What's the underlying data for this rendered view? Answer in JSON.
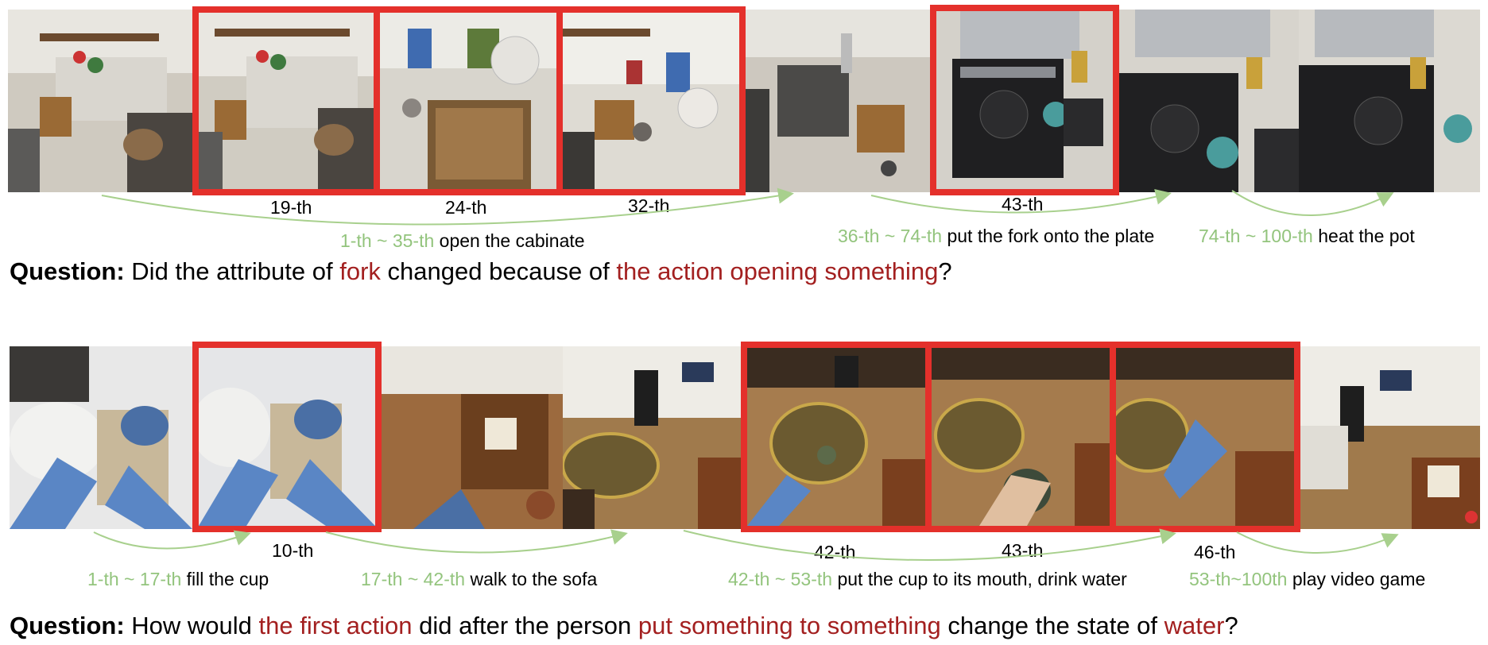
{
  "colors": {
    "highlight_border": "#e4302b",
    "action_range": "#93c47d",
    "question_highlight": "#a32020",
    "arrow": "#a8d08d"
  },
  "example1": {
    "frame_labels": [
      "19-th",
      "24-th",
      "32-th",
      "43-th"
    ],
    "segments": [
      {
        "range": "1-th ~ 35-th",
        "action": "open the cabinate"
      },
      {
        "range": "36-th ~ 74-th",
        "action": "put the fork onto the plate"
      },
      {
        "range": "74-th ~ 100-th",
        "action": "heat the pot"
      }
    ],
    "question": {
      "prefix": "Question:",
      "p1": "Did the attribute of ",
      "h1": "fork",
      "p2": " changed because of ",
      "h2": "the action opening something",
      "p3": "?"
    }
  },
  "example2": {
    "frame_labels": [
      "10-th",
      "42-th",
      "43-th",
      "46-th"
    ],
    "segments": [
      {
        "range": "1-th ~ 17-th",
        "action": "fill the cup"
      },
      {
        "range": "17-th ~ 42-th",
        "action": "walk to the sofa"
      },
      {
        "range": "42-th ~ 53-th",
        "action": "put the cup to its mouth, drink water"
      },
      {
        "range": "53-th~100th",
        "action": "play video game"
      }
    ],
    "question": {
      "prefix": "Question:",
      "p1": "How would ",
      "h1": "the first action",
      "p2": " did after the person ",
      "h2": "put something to something",
      "p3": " change the state of ",
      "h3": "water",
      "p4": "?"
    }
  }
}
